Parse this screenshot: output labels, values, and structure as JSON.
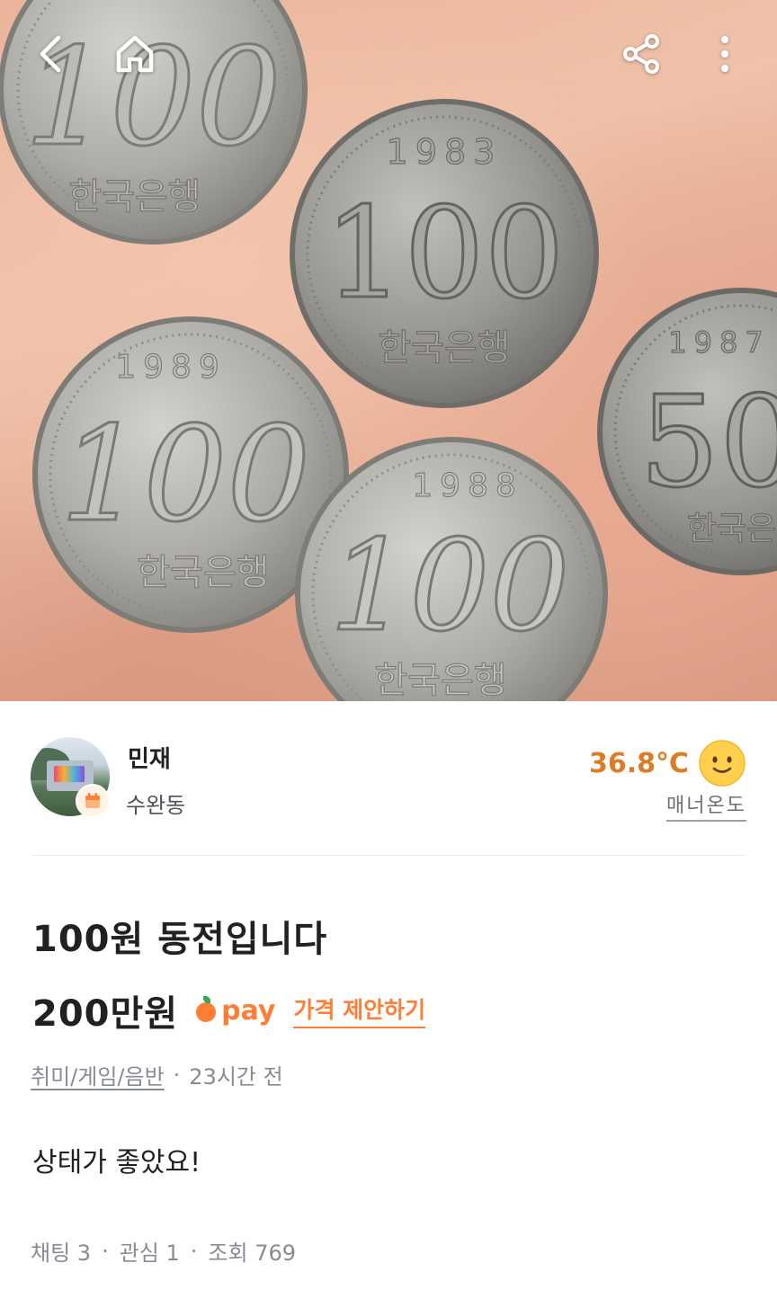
{
  "photo": {
    "alt": "",
    "coin_values": [
      "100",
      "100",
      "100",
      "100",
      "50"
    ],
    "coin_years": [
      "1983",
      "1989",
      "1988",
      "1987"
    ],
    "coin_bank": "한국은행"
  },
  "topbar": {
    "back_icon": "chevron-left-icon",
    "home_icon": "home-icon",
    "share_icon": "share-icon",
    "more_icon": "more-vertical-icon"
  },
  "seller": {
    "nickname": "민재",
    "region": "수완동",
    "temperature": "36.8°C",
    "manner_label": "매너온도",
    "temp_color": "#de7b26"
  },
  "listing": {
    "title": "100원 동전입니다",
    "price": "200만원",
    "pay_label": "pay",
    "offer_label": "가격 제안하기",
    "category": "취미/게임/음반",
    "time_ago": "23시간 전",
    "description": "상태가 좋았요!"
  },
  "stats": {
    "chats": "채팅 3",
    "likes": "관심 1",
    "views": "조회 769"
  },
  "colors": {
    "accent": "#ff7e36",
    "text": "#212124",
    "muted": "#868b94"
  }
}
